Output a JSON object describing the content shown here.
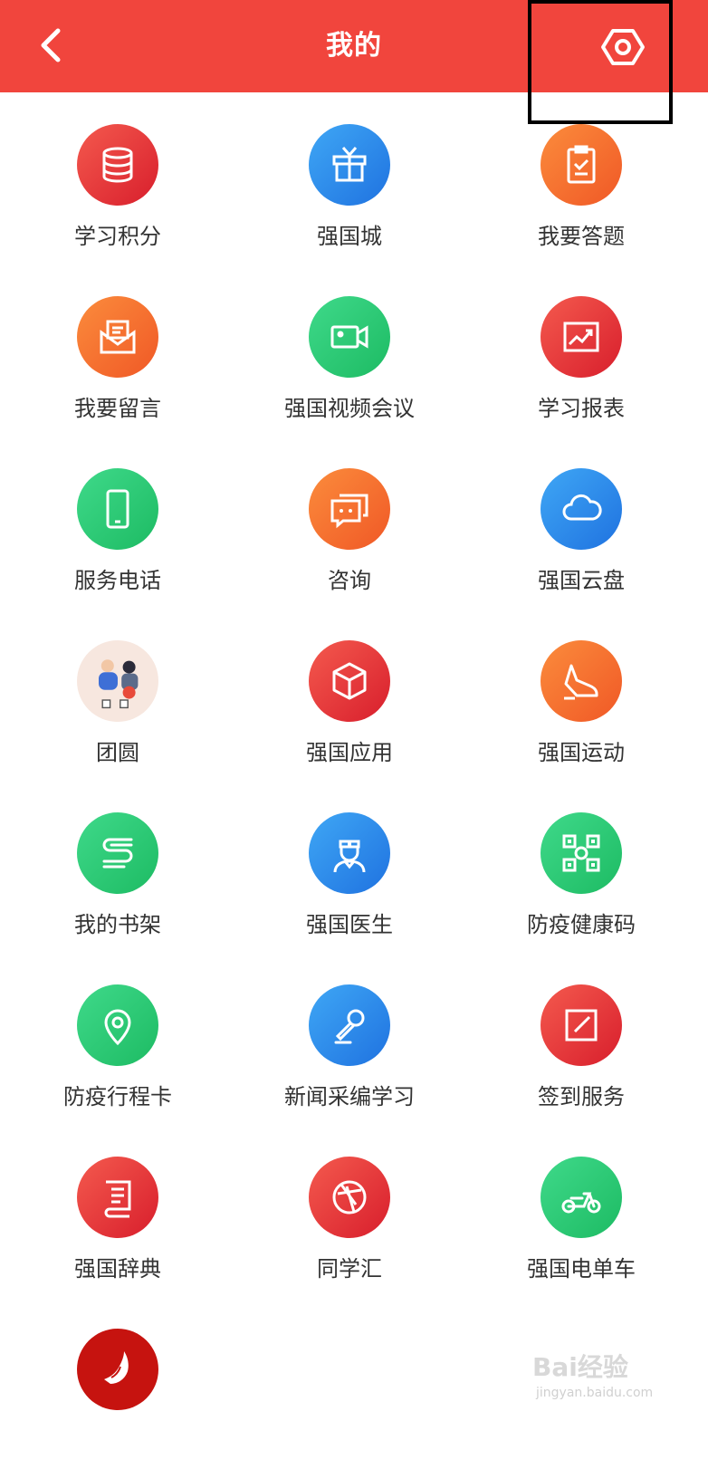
{
  "header": {
    "title": "我的",
    "back_icon": "chevron-left-icon",
    "settings_icon": "hexagon-settings-icon",
    "color": "#f1453d"
  },
  "items": [
    {
      "label": "学习积分",
      "icon": "database-icon",
      "color": "red"
    },
    {
      "label": "强国城",
      "icon": "gift-box-icon",
      "color": "blue"
    },
    {
      "label": "我要答题",
      "icon": "clipboard-check-icon",
      "color": "orange"
    },
    {
      "label": "我要留言",
      "icon": "mail-envelope-icon",
      "color": "orange"
    },
    {
      "label": "强国视频会议",
      "icon": "video-camera-icon",
      "color": "green"
    },
    {
      "label": "学习报表",
      "icon": "chart-report-icon",
      "color": "red"
    },
    {
      "label": "服务电话",
      "icon": "phone-icon",
      "color": "green"
    },
    {
      "label": "咨询",
      "icon": "chat-bubble-icon",
      "color": "orange"
    },
    {
      "label": "强国云盘",
      "icon": "cloud-icon",
      "color": "blue"
    },
    {
      "label": "团圆",
      "icon": "reunion-illustration-icon",
      "color": "pale"
    },
    {
      "label": "强国应用",
      "icon": "cube-icon",
      "color": "red"
    },
    {
      "label": "强国运动",
      "icon": "sneaker-icon",
      "color": "orange"
    },
    {
      "label": "我的书架",
      "icon": "bookshelf-icon",
      "color": "green"
    },
    {
      "label": "强国医生",
      "icon": "doctor-icon",
      "color": "blue"
    },
    {
      "label": "防疫健康码",
      "icon": "qr-code-icon",
      "color": "green"
    },
    {
      "label": "防疫行程卡",
      "icon": "location-pin-icon",
      "color": "green"
    },
    {
      "label": "新闻采编学习",
      "icon": "microphone-icon",
      "color": "blue"
    },
    {
      "label": "签到服务",
      "icon": "pen-sign-icon",
      "color": "red"
    },
    {
      "label": "强国辞典",
      "icon": "dictionary-book-icon",
      "color": "red"
    },
    {
      "label": "同学汇",
      "icon": "aperture-icon",
      "color": "red"
    },
    {
      "label": "强国电单车",
      "icon": "e-scooter-icon",
      "color": "green"
    },
    {
      "label": "",
      "icon": "red-logo-icon",
      "color": "dark"
    }
  ],
  "watermark": {
    "text": "Bai经验",
    "sub": "jingyan.baidu.com"
  }
}
